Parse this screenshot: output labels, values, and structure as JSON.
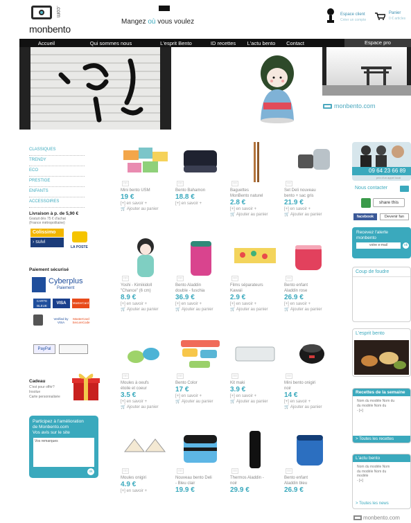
{
  "header": {
    "logo_text": "monbento",
    "logo_com": ".com",
    "tagline_pre": "Mangez ",
    "tagline_ou": "où",
    "tagline_post": " vous voulez",
    "espace_client": "Espace client",
    "espace_client_sub": "Créer un compte",
    "panier": "Panier",
    "panier_sub": "0 € articles"
  },
  "nav": {
    "items": [
      "Accueil",
      "Qui sommes nous",
      "L'esprit Bento",
      "ID recettes",
      "L'actu bento",
      "Contact"
    ],
    "pro": "Espace pro"
  },
  "banner": {
    "logo_text": "monbento.com"
  },
  "sidebar": {
    "categories": [
      "CLASSIQUES",
      "TRENDY",
      "ECO",
      "PRESTIGE",
      "ENFANTS",
      "ACCESSOIRES"
    ],
    "livraison_title": "Livraison  à p. de 5,90 €",
    "livraison_sub1": "Gratuit dès 75 € d'achat",
    "livraison_sub2": "(France métropolitaine)",
    "colissimo": "Colissimo",
    "suivi": "› suivi",
    "laposte": "LA POSTE",
    "paiement_title": "Paiement sécurisé",
    "cyberplus": "Cyberplus",
    "cyberplus_sub": "Paiement",
    "cb": "CARTE BLEUE",
    "visa": "VISA",
    "mastercard": "MasterCard",
    "verified": "Verified by VISA",
    "securecode": "MasterCard SecureCode",
    "paypal": "PayPal",
    "cadeau_title": "Cadeau",
    "cadeau_sub1": "C'est pour offrir?",
    "cadeau_sub2": "Insolue",
    "cadeau_sub3": "Carte personnalisée",
    "feedback_title1": "Participez à l'amélioration",
    "feedback_title2": "de Monbento.com",
    "feedback_title3": "Vos avis sur le site",
    "feedback_placeholder": "Vos remarques",
    "feedback_ok": "ok"
  },
  "products": [
    {
      "name1": "Mini bento USM",
      "name2": "",
      "price": "19 €",
      "more": "[+] en savoir +",
      "cart": "Ajouter au panier"
    },
    {
      "name1": "Bento Bahamon",
      "name2": "",
      "price": "18.8 €",
      "more": "[+] en savoir +",
      "cart": ""
    },
    {
      "name1": "Baguettes",
      "name2": "MonBento naturel",
      "price": "2.8 €",
      "more": "[+] en savoir +",
      "cart": "Ajouter au panier"
    },
    {
      "name1": "Set Deli nouveau",
      "name2": "bento + sac gris",
      "price": "21.9 €",
      "more": "[+] en savoir +",
      "cart": "Ajouter au panier"
    },
    {
      "name1": "Yoshi - Kimikidoll",
      "name2": "\"Chance\" (6 cm)",
      "price": "8.9 €",
      "more": "[+] en savoir +",
      "cart": "Ajouter au panier"
    },
    {
      "name1": "Bento Aladdin",
      "name2": "double - fuschia",
      "price": "36.9 €",
      "more": "[+] en savoir +",
      "cart": "Ajouter au panier"
    },
    {
      "name1": "Films séparateurs",
      "name2": "Kawaii",
      "price": "2.9 €",
      "more": "[+] en savoir +",
      "cart": "Ajouter au panier"
    },
    {
      "name1": "Bento enfant",
      "name2": "Aladdin rose",
      "price": "26.9 €",
      "more": "[+] en savoir +",
      "cart": "Ajouter au panier"
    },
    {
      "name1": "Moules à oeufs",
      "name2": "étoile et coeur",
      "price": "3.5 €",
      "more": "[+] en savoir +",
      "cart": "Ajouter au panier"
    },
    {
      "name1": "Bento Color",
      "name2": "",
      "price": "17 €",
      "more": "[+] en savoir +",
      "cart": "Ajouter au panier"
    },
    {
      "name1": "Kit maki",
      "name2": "",
      "price": "3.9 €",
      "more": "[+] en savoir +",
      "cart": "Ajouter au panier"
    },
    {
      "name1": "Mini bento onigiri",
      "name2": "noir",
      "price": "14 €",
      "more": "[+] en savoir +",
      "cart": "Ajouter au panier"
    },
    {
      "name1": "Moules onigiri",
      "name2": "",
      "price": "4.9 €",
      "more": "[+] en savoir +",
      "cart": ""
    },
    {
      "name1": "Nouveau bento Deli",
      "name2": "- Bleu clair",
      "price": "19.9 €",
      "more": "",
      "cart": ""
    },
    {
      "name1": "Thermos Aladdin -",
      "name2": "noir",
      "price": "29.9 €",
      "more": "",
      "cart": ""
    },
    {
      "name1": "Bento enfant",
      "name2": "Aladdin bleu",
      "price": "26.9 €",
      "more": "",
      "cart": ""
    }
  ],
  "right": {
    "phone": "09 64 23 66 89",
    "phone_sub": "prix d'un appel local",
    "contact": "Nous contacter",
    "share": "share this",
    "facebook": "facebook",
    "fan": "Devenir fan",
    "alerts_title1": "Recevez l'alerte",
    "alerts_title2": "monbento",
    "email_placeholder": "votre e-mail",
    "ok": "ok",
    "coup_title": "Coup de foudre",
    "esprit_title": "L'esprit bento",
    "recettes_title": "Recettes de la semaine",
    "recettes_text1": "Nom du modèle Nom du",
    "recettes_text2": "du modèle Nom du",
    "recettes_text3": "- [+]",
    "recettes_more": "> Toutes les recettes",
    "actu_title": "L'actu bento",
    "actu_text1": "Nom du modèle Nom",
    "actu_text2": "du modèle Nom du",
    "actu_text3": "modèle",
    "actu_text4": "- [+]",
    "actu_more": "> Toutes les news",
    "footer_logo": "monbento.com"
  },
  "colors": {
    "accent": "#3aa9bd",
    "nav": "#111111"
  }
}
